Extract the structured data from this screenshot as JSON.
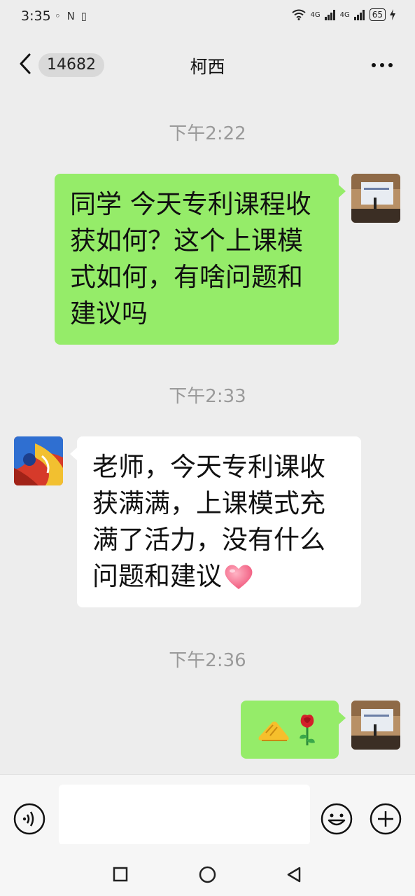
{
  "status_bar": {
    "time": "3:35",
    "left_icons": "◦ N ▯",
    "net1": "4G",
    "net2": "4G",
    "battery": "65"
  },
  "header": {
    "unread_count": "14682",
    "title": "柯西"
  },
  "messages": [
    {
      "time": "下午2:22",
      "sender": "self",
      "text": "同学 今天专利课程收获如何？这个上课模式如何，有啥问题和建议吗"
    },
    {
      "time": "下午2:33",
      "sender": "other",
      "text": "老师，今天专利课收获满满，上课模式充满了活力，没有什么问题和建议",
      "emoji": "heart-emoji"
    },
    {
      "time": "下午2:36",
      "sender": "self",
      "emojis": [
        "clap-emoji",
        "rose-emoji"
      ]
    }
  ],
  "input": {
    "value": "",
    "placeholder": ""
  },
  "icons": {
    "back": "chevron-left-icon",
    "more": "more-dots-icon",
    "voice": "voice-icon",
    "emoji": "smiley-icon",
    "add": "plus-icon",
    "nav_recent": "square-icon",
    "nav_home": "circle-icon",
    "nav_back": "triangle-back-icon"
  },
  "colors": {
    "background": "#ededed",
    "self_bubble": "#95ec69",
    "other_bubble": "#ffffff",
    "time_label": "#9a9a9a"
  }
}
